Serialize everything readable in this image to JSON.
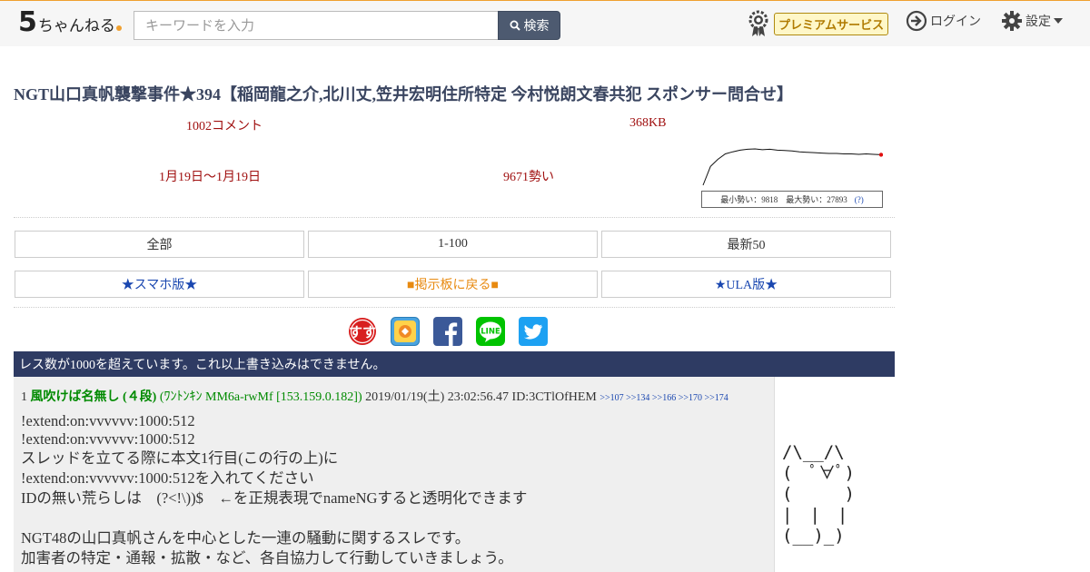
{
  "header": {
    "logo_mark": "5",
    "logo_text": "ちゃんねる",
    "search_placeholder": "キーワードを入力",
    "search_button": "検索",
    "premium_label": "プレミアムサービス",
    "login_label": "ログイン",
    "settings_label": "設定"
  },
  "thread": {
    "title": "NGT山口真帆襲撃事件★394【稲岡龍之介,北川丈,笠井宏明住所特定 今村悦朗文春共犯 スポンサー問合せ】",
    "comments": "1002コメント",
    "size": "368KB",
    "date_range": "1月19日〜1月19日",
    "momentum": "9671勢い",
    "graph_legend": "最小勢い：9818　最大勢い：27893",
    "graph_help": "(?)",
    "graph_points": [
      0.0,
      0.45,
      0.62,
      0.75,
      0.8,
      0.84,
      0.86,
      0.87,
      0.85,
      0.86,
      0.84,
      0.83,
      0.82,
      0.8,
      0.79,
      0.78,
      0.77,
      0.76,
      0.76,
      0.75,
      0.75,
      0.74,
      0.75,
      0.74,
      0.73
    ]
  },
  "nav": {
    "all": "全部",
    "first100": "1-100",
    "latest50": "最新50",
    "smartphone": "★スマホ版★",
    "back_to_board": "■掲示板に戻る■",
    "ula": "★ULA版★"
  },
  "notice": "レス数が1000を超えています。これ以上書き込みはできません。",
  "post": {
    "number": "1",
    "name": "風吹けば名無し (４段)",
    "trip": "(ﾜﾝﾄﾝｷﾝ MM6a-rwMf [153.159.0.182])",
    "date": "2019/01/19(土) 23:02:56.47",
    "id": "ID:3CTlOfHEM",
    "refs": [
      ">>107",
      ">>134",
      ">>166",
      ">>170",
      ">>174"
    ],
    "lines": [
      "!extend:on:vvvvvv:1000:512",
      "!extend:on:vvvvvv:1000:512",
      "スレッドを立てる際に本文1行目(この行の上)に",
      "!extend:on:vvvvvv:1000:512を入れてください",
      "IDの無い荒らしは　(?<!\\))$　←を正規表現でnameNGすると透明化できます",
      "",
      "NGT48の山口真帆さんを中心とした一連の騒動に関するスレです。",
      "加害者の特定・通報・拡散・など、各自協力して行動していきましょう。"
    ]
  },
  "side_art": "/\\__/\\\n(　ﾟ∀ﾟ)\n(　　　)\n|　|　|\n(__)_)"
}
